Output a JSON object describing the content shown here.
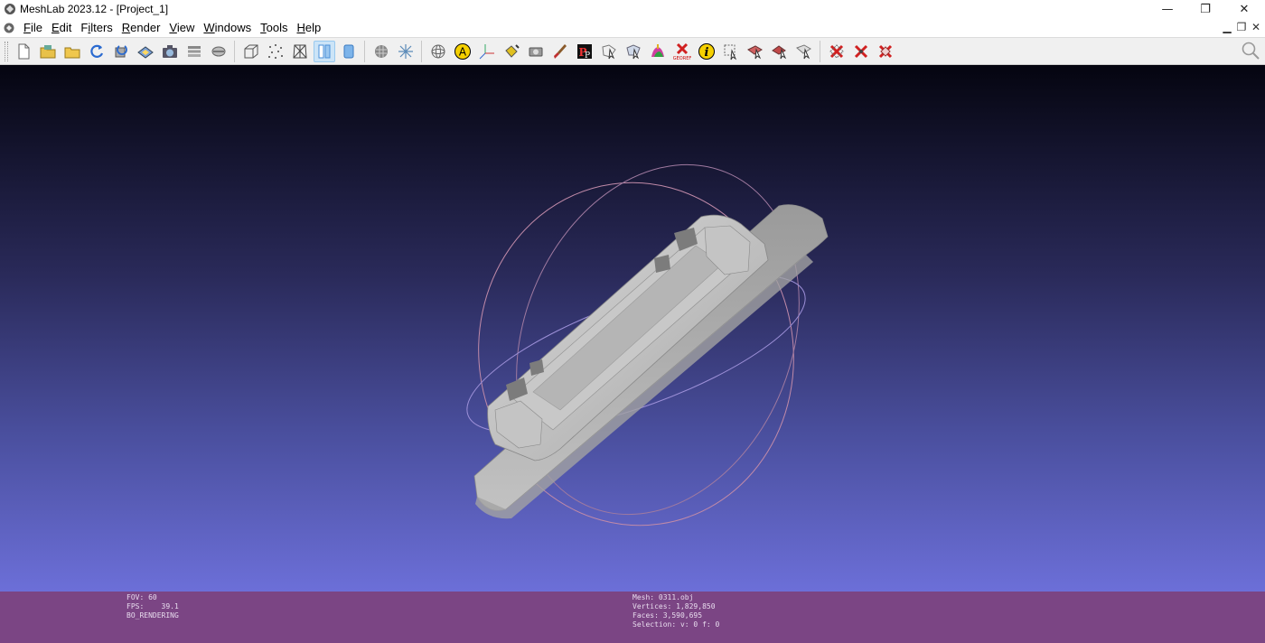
{
  "window": {
    "title": "MeshLab 2023.12 - [Project_1]",
    "controls": {
      "minimize": "—",
      "restore": "❐",
      "close": "✕"
    }
  },
  "menu": {
    "items": [
      {
        "label": "File",
        "mnemonic": "F"
      },
      {
        "label": "Edit",
        "mnemonic": "E"
      },
      {
        "label": "Filters",
        "mnemonic": "i"
      },
      {
        "label": "Render",
        "mnemonic": "R"
      },
      {
        "label": "View",
        "mnemonic": "V"
      },
      {
        "label": "Windows",
        "mnemonic": "W"
      },
      {
        "label": "Tools",
        "mnemonic": "T"
      },
      {
        "label": "Help",
        "mnemonic": "H"
      }
    ],
    "mdi_controls": {
      "minimize": "▁",
      "restore": "❐",
      "close": "✕"
    }
  },
  "toolbar": {
    "groups": [
      [
        "new-project",
        "open-project",
        "import-mesh",
        "reload",
        "reload-all",
        "export-mesh",
        "snapshot",
        "layers",
        "raster-layers"
      ],
      [
        "bounding-box",
        "points",
        "wireframe",
        "flat-lines",
        "smooth"
      ],
      [
        "layer-dialog",
        "decorate-axes"
      ],
      [
        "trackball",
        "axes-a",
        "light-axes",
        "color-bucket",
        "camera",
        "paint-brush",
        "pick-points",
        "select-faces",
        "select-vertices",
        "paint-color",
        "georef",
        "info",
        "select-connected",
        "manipulator",
        "align",
        "measure"
      ],
      [
        "delete-faces",
        "delete-vertices",
        "delete-selected"
      ]
    ]
  },
  "viewport": {
    "colors": {
      "top": "#050510",
      "bottom": "#6c6fd8",
      "mesh": "#b9b9b9"
    }
  },
  "status": {
    "left_lines": [
      "FOV: 60",
      "FPS:    39.1",
      "BO_RENDERING"
    ],
    "right_lines": [
      "Mesh: 0311.obj",
      "Vertices: 1,829,850",
      "Faces: 3,590,695",
      "Selection: v: 0 f: 0"
    ]
  }
}
